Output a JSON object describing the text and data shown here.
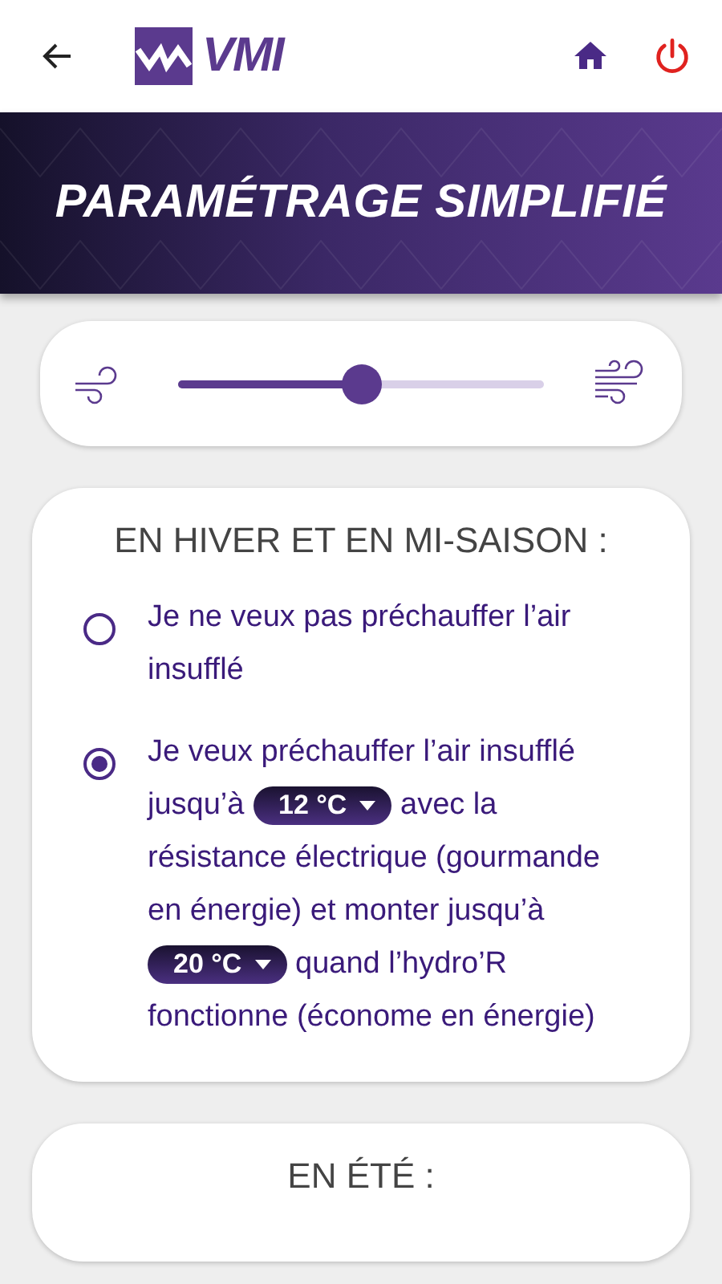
{
  "app_bar": {
    "logo_text": "VMI"
  },
  "banner": {
    "title": "PARAMÉTRAGE SIMPLIFIÉ"
  },
  "fan_speed": {
    "level": 0.5
  },
  "sections": [
    {
      "title": "EN HIVER ET EN MI-SAISON :",
      "options": [
        {
          "selected": false,
          "parts": [
            {
              "kind": "text",
              "text": "Je ne veux pas préchauffer l’air insufflé"
            }
          ]
        },
        {
          "selected": true,
          "parts": [
            {
              "kind": "text",
              "text": "Je veux préchauffer l’air insufflé jusqu’à"
            },
            {
              "kind": "select",
              "value": "12 °C"
            },
            {
              "kind": "text",
              "text": "avec la résistance électrique (gourmande en énergie) et monter jusqu’à"
            },
            {
              "kind": "select",
              "value": "20 °C"
            },
            {
              "kind": "text",
              "text": "quand l’hydro’R fonctionne (économe en énergie)"
            }
          ]
        }
      ]
    },
    {
      "title": "EN ÉTÉ :"
    }
  ]
}
